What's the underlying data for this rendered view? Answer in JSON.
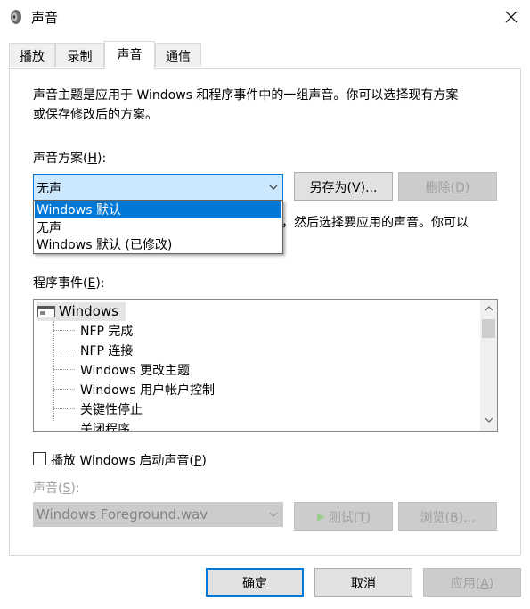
{
  "window": {
    "title": "声音"
  },
  "tabs": [
    {
      "label": "播放"
    },
    {
      "label": "录制"
    },
    {
      "label": "声音"
    },
    {
      "label": "通信"
    }
  ],
  "description": {
    "line1": "声音主题是应用于 Windows 和程序事件中的一组声音。你可以选择现有方案",
    "line2": "或保存修改后的方案。"
  },
  "scheme": {
    "label_pre": "声音方案(",
    "label_key": "H",
    "label_post": "):",
    "selected": "无声",
    "options": [
      "Windows 默认",
      "无声",
      "Windows 默认 (已修改)"
    ],
    "hidden_text": "，然后选择要应用的声音。你可以"
  },
  "buttons": {
    "save_as_pre": "另存为(",
    "save_as_key": "V",
    "save_as_post": ")...",
    "delete_pre": "删除(",
    "delete_key": "D",
    "delete_post": ")",
    "test_pre": "测试(",
    "test_key": "T",
    "test_post": ")",
    "browse_pre": "浏览(",
    "browse_key": "B",
    "browse_post": ")...",
    "ok": "确定",
    "cancel": "取消",
    "apply_pre": "应用(",
    "apply_key": "A",
    "apply_post": ")"
  },
  "events": {
    "label_pre": "程序事件(",
    "label_key": "E",
    "label_post": "):",
    "root": "Windows",
    "items": [
      "NFP 完成",
      "NFP 连接",
      "Windows 更改主题",
      "Windows 用户帐户控制",
      "关键性停止",
      "关闭程序"
    ]
  },
  "startup": {
    "label_pre": "播放 Windows 启动声音(",
    "label_key": "P",
    "label_post": ")",
    "checked": false
  },
  "sound": {
    "label_pre": "声音(",
    "label_key": "S",
    "label_post": "):",
    "value": "Windows Foreground.wav"
  }
}
